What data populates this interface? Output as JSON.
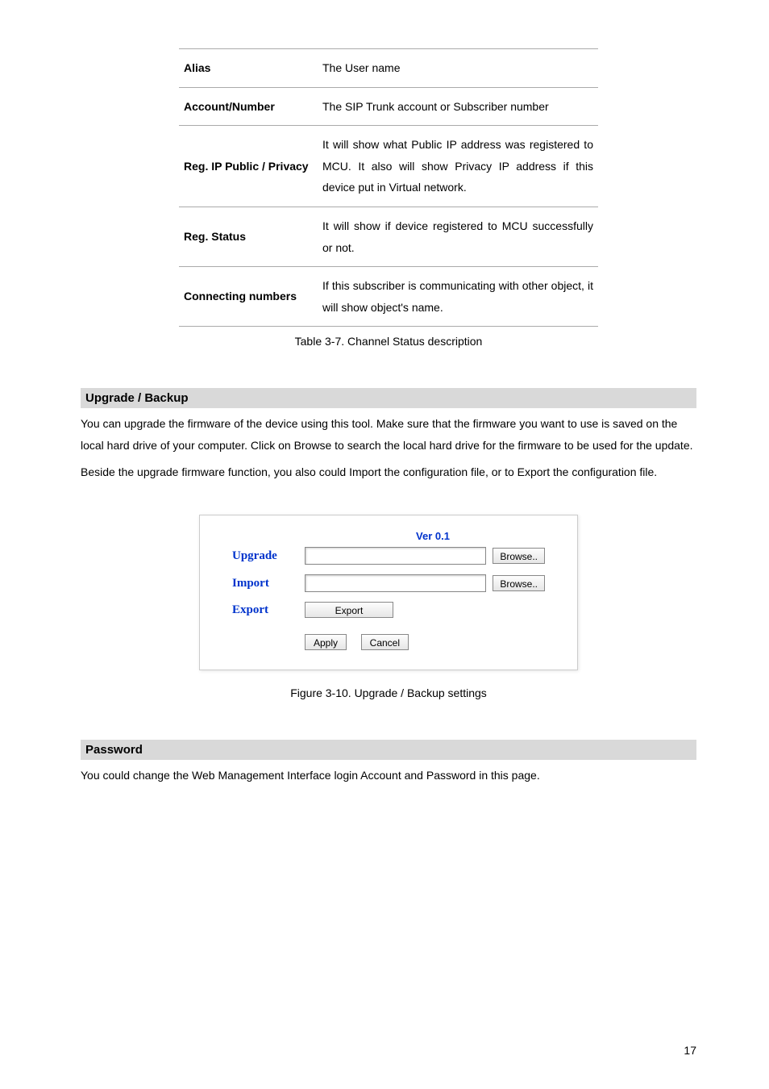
{
  "table": {
    "rows": [
      {
        "label": "Alias",
        "value": "The User name"
      },
      {
        "label": "Account/Number",
        "value": "The SIP Trunk account or Subscriber number"
      },
      {
        "label": "Reg. IP Public / Privacy",
        "value": "It will show what Public IP address was registered to MCU. It also will show Privacy IP address if this device put in Virtual network."
      },
      {
        "label": "Reg. Status",
        "value": "It will show if device registered to MCU successfully or not."
      },
      {
        "label": "Connecting numbers",
        "value": "If this subscriber is communicating with other object, it will show object's name."
      }
    ],
    "caption": "Table 3-7. Channel Status description"
  },
  "section1": {
    "heading": "Upgrade / Backup",
    "para1": "You can upgrade the firmware of the device using this tool. Make sure that the firmware you want to use is saved on the local hard drive of your computer. Click on Browse to search the local hard drive for the firmware to be used for the update.",
    "para2": "Beside the upgrade firmware function, you also could Import the configuration file, or to Export the configuration file."
  },
  "uiPanel": {
    "version": "Ver 0.1",
    "upgradeLabel": "Upgrade",
    "importLabel": "Import",
    "exportLabel": "Export",
    "browseBtn": "Browse..",
    "exportBtn": "Export",
    "applyBtn": "Apply",
    "cancelBtn": "Cancel"
  },
  "figureCaption": "Figure 3-10. Upgrade / Backup settings",
  "section2": {
    "heading": "Password",
    "para1": "You could change the Web Management Interface login Account and Password in this page."
  },
  "pageNumber": "17"
}
